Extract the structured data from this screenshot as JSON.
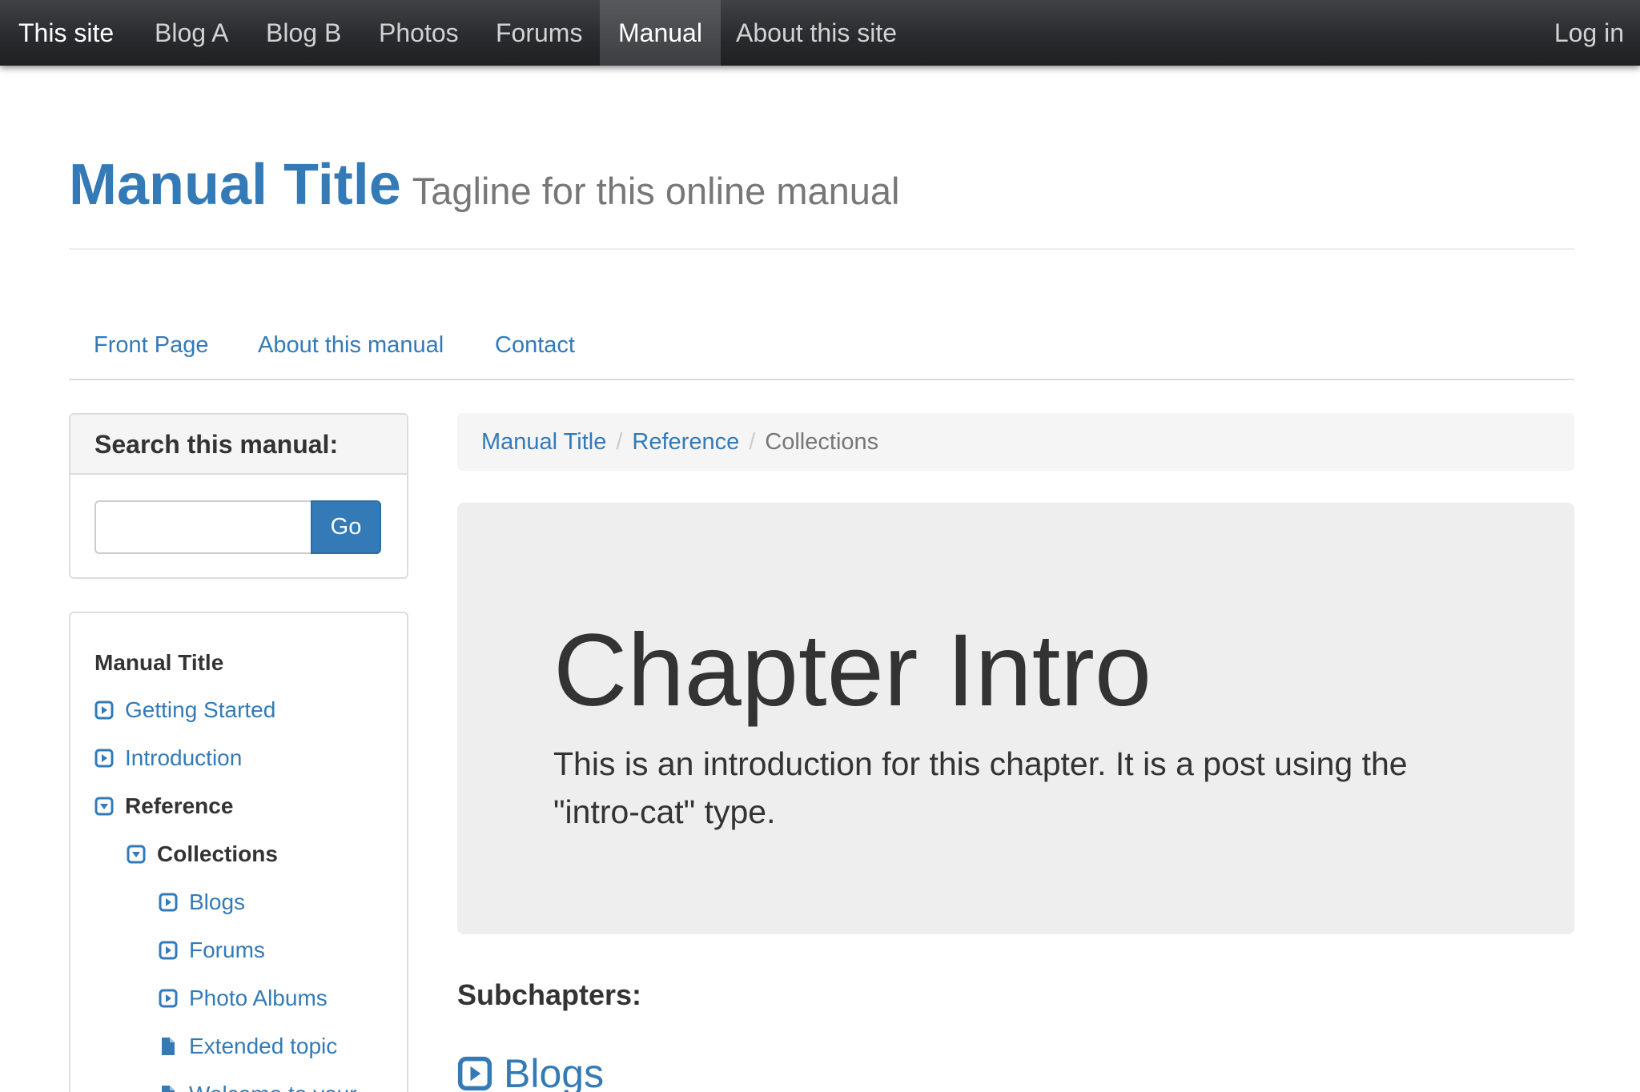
{
  "navbar": {
    "brand": "This site",
    "items": [
      {
        "label": "Blog A"
      },
      {
        "label": "Blog B"
      },
      {
        "label": "Photos"
      },
      {
        "label": "Forums"
      },
      {
        "label": "Manual",
        "active": true
      },
      {
        "label": "About this site"
      }
    ],
    "login": "Log in"
  },
  "masthead": {
    "title": "Manual Title",
    "tagline": "Tagline for this online manual"
  },
  "subnav": {
    "items": [
      {
        "label": "Front Page"
      },
      {
        "label": "About this manual"
      },
      {
        "label": "Contact"
      }
    ]
  },
  "search": {
    "heading": "Search this manual:",
    "value": "",
    "placeholder": "",
    "button": "Go"
  },
  "toc": {
    "heading": "Manual Title",
    "items": [
      {
        "label": "Getting Started",
        "icon": "expand-icon"
      },
      {
        "label": "Introduction",
        "icon": "expand-icon"
      },
      {
        "label": "Reference",
        "icon": "collapse-icon",
        "current": true
      },
      {
        "label": "Collections",
        "icon": "collapse-icon",
        "current": true
      },
      {
        "label": "Blogs",
        "icon": "expand-icon"
      },
      {
        "label": "Forums",
        "icon": "expand-icon"
      },
      {
        "label": "Photo Albums",
        "icon": "expand-icon"
      },
      {
        "label": "Extended topic",
        "icon": "file-icon"
      },
      {
        "label": "Welcome to your",
        "icon": "file-icon"
      }
    ]
  },
  "breadcrumb": {
    "items": [
      "Manual Title",
      "Reference"
    ],
    "current": "Collections",
    "separator": "/"
  },
  "jumbotron": {
    "heading": "Chapter Intro",
    "text": "This is an introduction for this chapter. It is a post using the \"intro-cat\" type."
  },
  "subchapters": {
    "heading": "Subchapters:",
    "items": [
      {
        "label": "Blogs",
        "icon": "expand-icon"
      }
    ]
  },
  "colors": {
    "link": "#337ab7",
    "navbar": "#222222",
    "jumbotron": "#eeeeee",
    "panel_heading": "#f5f5f5"
  }
}
